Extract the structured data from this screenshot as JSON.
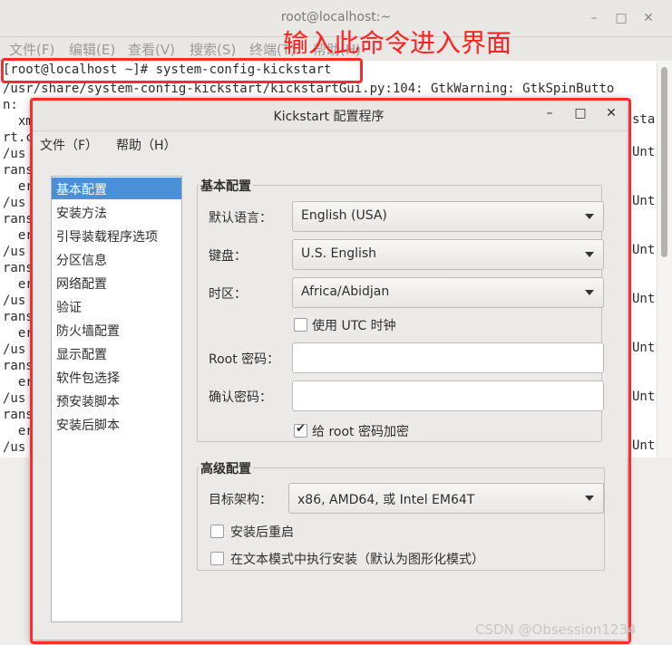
{
  "terminal": {
    "title": "root@localhost:~",
    "menu": [
      "文件(F)",
      "编辑(E)",
      "查看(V)",
      "搜索(S)",
      "终端(T)",
      "帮助(H)"
    ],
    "command": "[root@localhost ~]# system-config-kickstart",
    "lines": [
      "/usr/share/system-config-kickstart/kickstartGui.py:104: GtkWarning: GtkSpinButto",
      "n:",
      "  xm",
      "rt.c",
      "/us",
      "rans",
      "  er",
      "/us",
      "rans",
      "  er",
      "/us",
      "rans",
      "  er",
      "/us",
      "rans",
      "  er",
      "/us",
      "rans",
      "  er",
      "/us",
      "rans",
      "  er",
      "/us"
    ],
    "right_fragments": [
      "sta",
      "Unt",
      "Unt",
      "Unt",
      "Unt",
      "Unt",
      "Unt",
      "Unt"
    ]
  },
  "annotation": "输入此命令进入界面",
  "dialog": {
    "title": "Kickstart 配置程序",
    "menu": {
      "file": "文件（F）",
      "help": "帮助（H）"
    },
    "sidebar": [
      "基本配置",
      "安装方法",
      "引导装载程序选项",
      "分区信息",
      "网络配置",
      "验证",
      "防火墙配置",
      "显示配置",
      "软件包选择",
      "预安装脚本",
      "安装后脚本"
    ],
    "basic": {
      "section_title": "基本配置",
      "language_label": "默认语言：",
      "language_value": "English (USA)",
      "keyboard_label": "键盘：",
      "keyboard_value": "U.S. English",
      "timezone_label": "时区：",
      "timezone_value": "Africa/Abidjan",
      "utc_label": "使用  UTC 时钟",
      "utc_checked": false,
      "root_pw_label": "Root 密码：",
      "confirm_pw_label": "确认密码：",
      "encrypt_label": "给  root 密码加密",
      "encrypt_checked": true
    },
    "advanced": {
      "section_title": "高级配置",
      "arch_label": "目标架构：",
      "arch_value": "x86, AMD64, 或  Intel EM64T",
      "reboot_label": "安装后重启",
      "text_mode_label": "在文本模式中执行安装（默认为图形化模式）"
    }
  },
  "watermark": "CSDN @Obsession1234",
  "colors": {
    "accent": "#4a90d9",
    "annotation": "#ff2b2b"
  }
}
